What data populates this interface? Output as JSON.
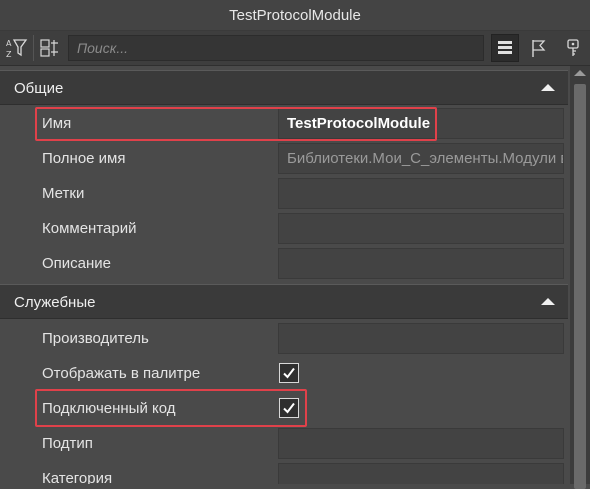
{
  "window": {
    "title": "TestProtocolModule"
  },
  "toolbar": {
    "search_placeholder": "Поиск...",
    "icons": [
      "sort-filter-icon",
      "category-icon",
      "list-view-icon",
      "flag-icon",
      "key-icon"
    ]
  },
  "sections": [
    {
      "label": "Общие",
      "rows": [
        {
          "name": "Имя",
          "value": "TestProtocolModule",
          "kind": "bold"
        },
        {
          "name": "Полное имя",
          "value": "Библиотеки.Мои_С_элементы.Модули в",
          "kind": "readonly"
        },
        {
          "name": "Метки",
          "value": "",
          "kind": "text"
        },
        {
          "name": "Комментарий",
          "value": "",
          "kind": "text"
        },
        {
          "name": "Описание",
          "value": "",
          "kind": "text"
        }
      ]
    },
    {
      "label": "Служебные",
      "rows": [
        {
          "name": "Производитель",
          "value": "",
          "kind": "text"
        },
        {
          "name": "Отображать в палитре",
          "checked": true,
          "kind": "checkbox"
        },
        {
          "name": "Подключенный код",
          "checked": true,
          "kind": "checkbox"
        },
        {
          "name": "Подтип",
          "value": "",
          "kind": "text"
        },
        {
          "name": "Категория",
          "value": "",
          "kind": "text"
        }
      ]
    }
  ],
  "colors": {
    "highlight": "#e0414a",
    "background": "#4a4a4a",
    "section_bg": "#3a3a3a"
  }
}
